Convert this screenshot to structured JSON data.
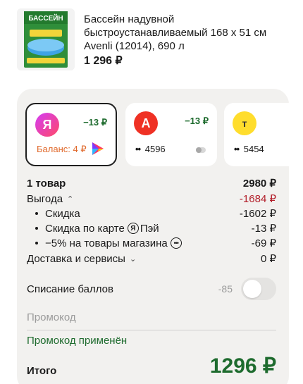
{
  "product": {
    "image_text": "БАССЕЙН",
    "title": "Бассейн надувной быстроустанавливаемый 168 х 51 см Avenli (12014), 690 л",
    "price": "1 296 ₽"
  },
  "payment_methods": [
    {
      "logo": "Я",
      "logo_color": "#ff4a68",
      "cashback": "−13 ₽",
      "balance": "Баланс: 4 ₽",
      "icon": "yandex-pay-icon",
      "selected": true
    },
    {
      "logo": "А",
      "logo_color": "#ef3124",
      "cashback": "−13 ₽",
      "dots": "••",
      "card": "4596",
      "icon": "toggle-icon"
    },
    {
      "logo": "т",
      "logo_color": "#ffdd2d",
      "dots": "••",
      "card": "5454"
    }
  ],
  "summary": {
    "items": {
      "label": "1 товар",
      "value": "2980 ₽"
    },
    "benefit": {
      "label": "Выгода",
      "value": "-1684 ₽"
    },
    "discount": {
      "label": "Скидка",
      "value": "-1602 ₽"
    },
    "card_discount": {
      "label_prefix": "Скидка по карте",
      "label_ya": "Я",
      "label_suffix": "Пэй",
      "value": "-13 ₽"
    },
    "store_discount": {
      "label": "−5% на товары магазина",
      "value": "-69 ₽"
    },
    "delivery": {
      "label": "Доставка и сервисы",
      "value": "0 ₽"
    }
  },
  "points": {
    "label": "Списание баллов",
    "value": "-85"
  },
  "promo": {
    "placeholder": "Промокод",
    "applied": "Промокод применён"
  },
  "total": {
    "label": "Итого",
    "value": "1296 ₽"
  },
  "colors": {
    "accent_green": "#1e6b2e",
    "benefit_red": "#b3202b",
    "balance_orange": "#e0682a",
    "card_bg": "#f2f1ef"
  }
}
